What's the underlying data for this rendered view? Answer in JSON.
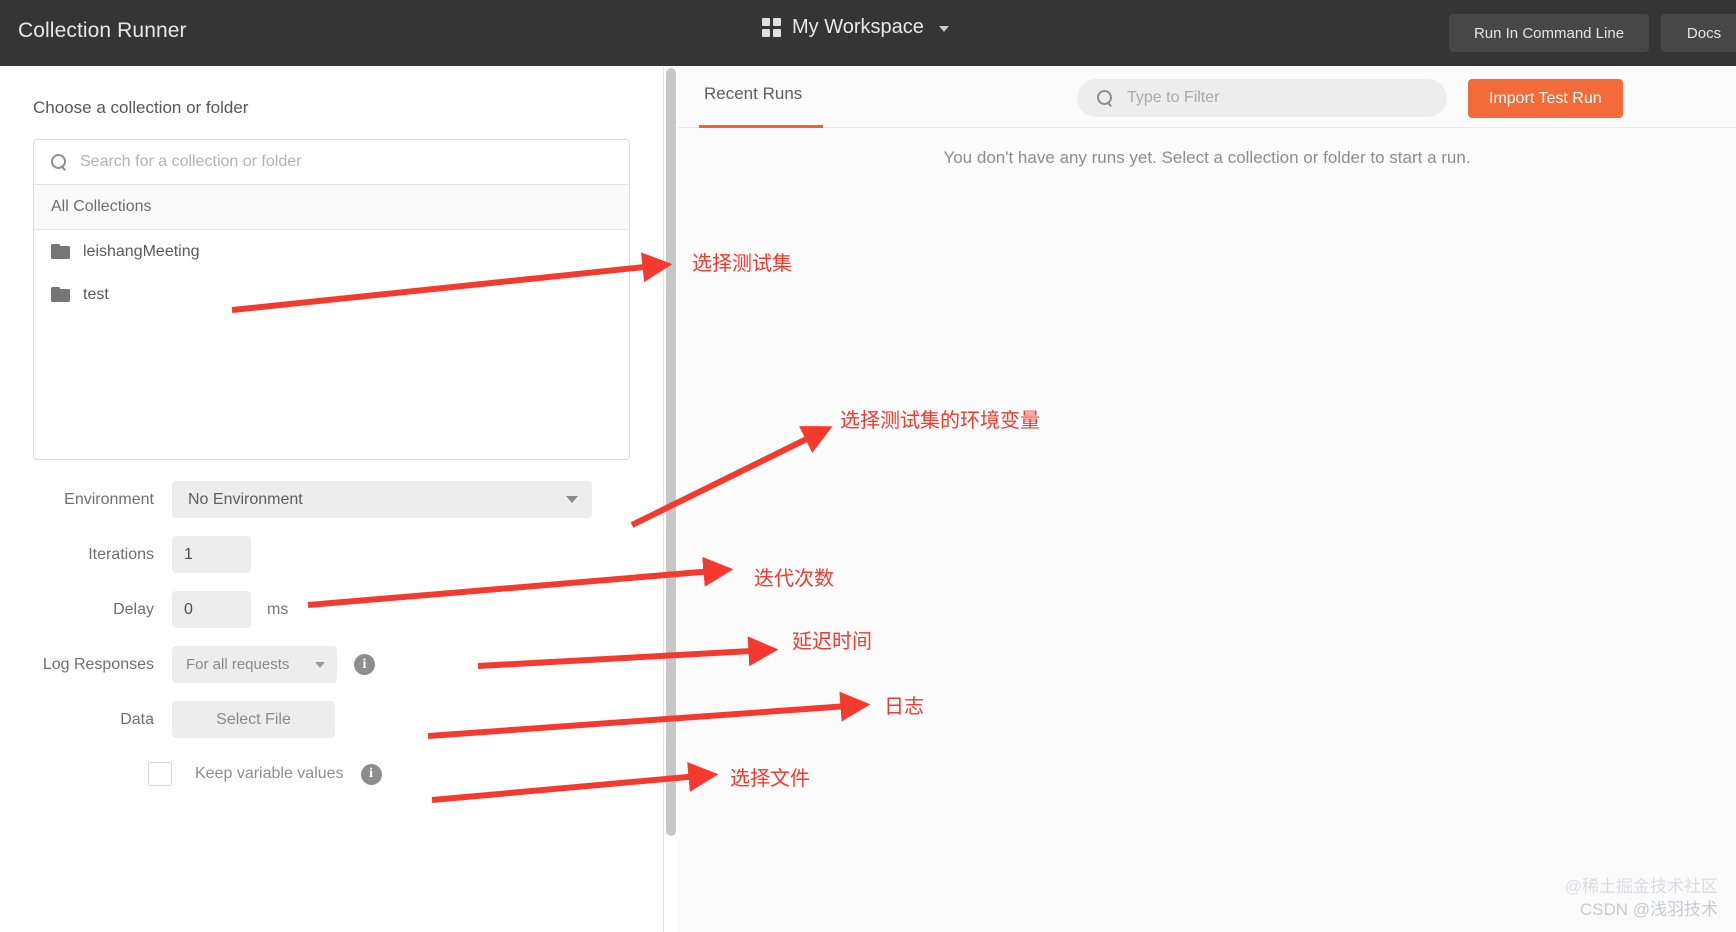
{
  "header": {
    "title": "Collection Runner",
    "workspace_name": "My Workspace",
    "workspace_icon": "grid-icon",
    "workspace_caret": "chevron-down-icon",
    "run_in_command_line_label": "Run In Command Line",
    "docs_label": "Docs",
    "background_color": "#353535"
  },
  "left_panel": {
    "choose_label": "Choose a collection or folder",
    "search": {
      "placeholder": "Search for a collection or folder",
      "value": "",
      "icon": "search-icon"
    },
    "all_collections_label": "All Collections",
    "folders": [
      {
        "name": "leishangMeeting",
        "icon": "folder-icon"
      },
      {
        "name": "test",
        "icon": "folder-icon"
      }
    ],
    "form": {
      "environment": {
        "label": "Environment",
        "value": "No Environment",
        "caret": "chevron-down-icon"
      },
      "iterations": {
        "label": "Iterations",
        "value": "1"
      },
      "delay": {
        "label": "Delay",
        "value": "0",
        "unit": "ms"
      },
      "log_responses": {
        "label": "Log Responses",
        "value": "For all requests",
        "caret": "chevron-down-icon",
        "info_icon": "info-icon"
      },
      "data": {
        "label": "Data",
        "button_label": "Select File"
      },
      "keep_variable_values": {
        "label": "Keep variable values",
        "checked": false,
        "info_icon": "info-icon"
      }
    }
  },
  "right_panel": {
    "tab_label": "Recent Runs",
    "tab_active_color": "#ef6330",
    "filter": {
      "placeholder": "Type to Filter",
      "value": "",
      "icon": "search-icon"
    },
    "import_button_label": "Import Test Run",
    "import_button_color": "#f26b38",
    "empty_message": "You don't have any runs yet. Select a collection or folder to start a run."
  },
  "annotations": {
    "color": "#f43a2e",
    "items": [
      {
        "text": "选择测试集"
      },
      {
        "text": "选择测试集的环境变量"
      },
      {
        "text": "迭代次数"
      },
      {
        "text": "延迟时间"
      },
      {
        "text": "日志"
      },
      {
        "text": "选择文件"
      }
    ]
  },
  "watermark": {
    "line1": "@稀土掘金技术社区",
    "line2": "CSDN @浅羽技术"
  }
}
